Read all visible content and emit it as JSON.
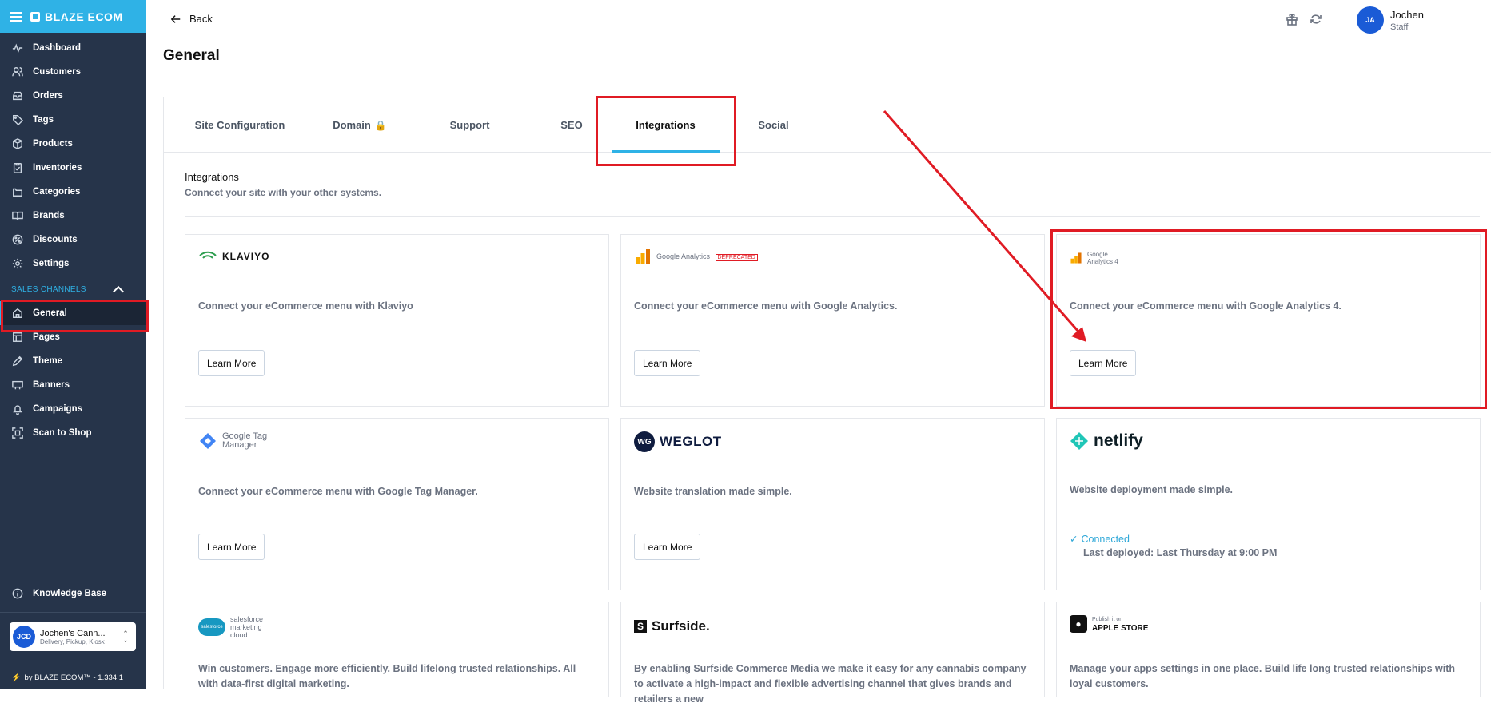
{
  "app": {
    "brand": "BLAZE ECOM",
    "footer": "by BLAZE ECOM™ - 1.334.1",
    "sections_label": "SALES CHANNELS"
  },
  "sidebar": {
    "items": [
      {
        "label": "Dashboard",
        "icon": "dashboard-icon"
      },
      {
        "label": "Customers",
        "icon": "customers-icon"
      },
      {
        "label": "Orders",
        "icon": "orders-icon"
      },
      {
        "label": "Tags",
        "icon": "tag-icon"
      },
      {
        "label": "Products",
        "icon": "products-icon"
      },
      {
        "label": "Inventories",
        "icon": "inventory-icon"
      },
      {
        "label": "Categories",
        "icon": "categories-icon"
      },
      {
        "label": "Brands",
        "icon": "brands-icon"
      },
      {
        "label": "Discounts",
        "icon": "discount-icon"
      },
      {
        "label": "Settings",
        "icon": "gear-icon"
      }
    ],
    "channel_items": [
      {
        "label": "General",
        "icon": "home-icon",
        "active": true
      },
      {
        "label": "Pages",
        "icon": "pages-icon"
      },
      {
        "label": "Theme",
        "icon": "theme-icon"
      },
      {
        "label": "Banners",
        "icon": "banner-icon"
      },
      {
        "label": "Campaigns",
        "icon": "bell-icon"
      },
      {
        "label": "Scan to Shop",
        "icon": "scan-icon"
      }
    ],
    "knowledge_base": "Knowledge Base",
    "store": {
      "initials": "JCD",
      "name": "Jochen's Cann...",
      "sub": "Delivery, Pickup, Kiosk"
    }
  },
  "header": {
    "back": "Back",
    "title": "General",
    "user": {
      "initials": "JA",
      "name": "Jochen",
      "role": "Staff"
    }
  },
  "tabs": [
    {
      "label": "Site Configuration"
    },
    {
      "label": "Domain",
      "locked": true
    },
    {
      "label": "Support"
    },
    {
      "label": "SEO"
    },
    {
      "label": "Integrations",
      "active": true
    },
    {
      "label": "Social"
    }
  ],
  "integrations": {
    "title": "Integrations",
    "subtitle": "Connect your site with your other systems.",
    "learn_more": "Learn More",
    "cards": [
      {
        "name": "KLAVIYO",
        "desc": "Connect your eCommerce menu with Klaviyo"
      },
      {
        "name": "Google Analytics",
        "badge": "DEPRECATED",
        "desc": "Connect your eCommerce menu with Google Analytics."
      },
      {
        "name": "Google Analytics 4",
        "desc": "Connect your eCommerce menu with Google Analytics 4."
      },
      {
        "name": "Google Tag Manager",
        "desc": "Connect your eCommerce menu with Google Tag Manager."
      },
      {
        "name": "WEGLOT",
        "desc": "Website translation made simple."
      },
      {
        "name": "netlify",
        "desc": "Website deployment made simple.",
        "status": "Connected",
        "deployed": "Last deployed: Last Thursday at 9:00 PM"
      },
      {
        "name": "salesforce marketing cloud",
        "desc": "Win customers. Engage more efficiently. Build lifelong trusted relationships. All with data-first digital marketing."
      },
      {
        "name": "Surfside.",
        "desc": "By enabling Surfside Commerce Media we make it easy for any cannabis company to activate a high-impact and flexible advertising channel that gives brands and retailers a new"
      },
      {
        "name": "APPLE STORE",
        "prefix": "Publish it on",
        "desc": "Manage your apps settings in one place. Build life long trusted relationships with loyal customers."
      }
    ]
  },
  "colors": {
    "sidebar": "#26344a",
    "brand": "#2fb2e6",
    "highlight": "#e01b24"
  }
}
